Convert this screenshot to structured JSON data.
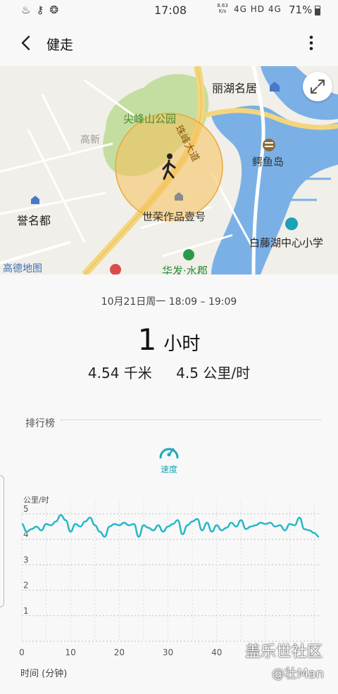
{
  "status_bar": {
    "time": "17:08",
    "net_speed": "8.63",
    "net_unit": "K/s",
    "signal": "4G HD 4G",
    "battery": "71%"
  },
  "app_bar": {
    "title": "健走"
  },
  "map": {
    "labels": {
      "lihu": "丽湖名居",
      "jianfeng": "尖峰山公园",
      "zhufeng": "珠峰大道",
      "gaoxin": "高新",
      "eyu": "鳄鱼岛",
      "yuming": "誉名都",
      "shirong": "世荣作品壹号",
      "baiteng": "白藤湖中心小学",
      "gaode": "高德地图",
      "huafa": "华发·水郡"
    },
    "colors": {
      "water": "#7ab0e6",
      "park": "#c3dea0",
      "road": "#f5d57c",
      "circle": "#f6c05a"
    }
  },
  "summary": {
    "date_range": "10月21日周一 18:09 – 19:09",
    "duration_value": "1",
    "duration_unit": "小时",
    "distance": "4.54 千米",
    "speed": "4.5 公里/时"
  },
  "ranking": {
    "title": "排行榜",
    "tab_label": "速度",
    "accent": "#1aa8bd"
  },
  "chart_data": {
    "type": "line",
    "ylabel": "公里/时",
    "xlabel": "时间 (分钟)",
    "ylim": [
      0,
      5
    ],
    "xlim": [
      0,
      61
    ],
    "y_ticks": [
      "1",
      "2",
      "3",
      "4",
      "5"
    ],
    "x_ticks": [
      "0",
      "10",
      "20",
      "30",
      "40"
    ],
    "grid": true,
    "series": [
      {
        "color": "#26b8c8",
        "x": [
          0,
          1,
          2,
          3,
          4,
          5,
          6,
          7,
          8,
          9,
          10,
          11,
          12,
          13,
          14,
          15,
          16,
          17,
          18,
          19,
          20,
          21,
          22,
          23,
          24,
          25,
          26,
          27,
          28,
          29,
          30,
          31,
          32,
          33,
          34,
          35,
          36,
          37,
          38,
          39,
          40,
          41,
          42,
          43,
          44,
          45,
          46,
          47,
          48,
          49,
          50,
          51,
          52,
          53,
          54,
          55,
          56,
          57,
          58,
          59,
          60,
          61
        ],
        "values": [
          4.6,
          4.3,
          4.4,
          4.5,
          4.35,
          4.6,
          4.55,
          4.7,
          4.95,
          4.75,
          4.3,
          4.6,
          4.5,
          4.7,
          4.85,
          4.55,
          4.3,
          4.1,
          4.5,
          4.6,
          4.55,
          4.65,
          4.55,
          4.6,
          4.1,
          4.55,
          4.45,
          4.35,
          4.55,
          4.3,
          4.5,
          4.6,
          4.75,
          4.2,
          4.55,
          4.7,
          4.8,
          4.35,
          4.65,
          4.3,
          4.55,
          4.35,
          4.45,
          4.65,
          4.5,
          4.75,
          4.4,
          4.5,
          4.55,
          4.65,
          4.6,
          4.65,
          4.5,
          4.55,
          4.35,
          4.6,
          4.55,
          4.85,
          4.4,
          4.35,
          4.25,
          4.1
        ]
      }
    ]
  },
  "watermark": {
    "line1": "盖乐世社区",
    "line2": "@壮Man"
  }
}
